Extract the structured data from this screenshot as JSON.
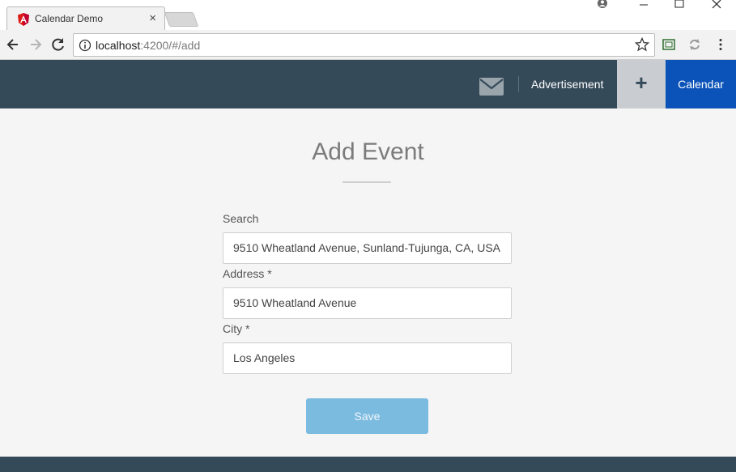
{
  "browser": {
    "tab": {
      "title": "Calendar Demo",
      "favicon": "angular-logo-icon",
      "close_icon": "close-icon"
    },
    "window_controls": [
      "account-icon",
      "minimize-icon",
      "maximize-icon",
      "close-window-icon"
    ],
    "address_bar": {
      "host": "localhost",
      "path": ":4200/#/add"
    },
    "toolbar_icons": [
      "back-icon",
      "forward-icon",
      "reload-icon",
      "info-icon",
      "star-icon",
      "cast-icon",
      "sync-icon",
      "menu-icon"
    ]
  },
  "header": {
    "mail_icon": "envelope-icon",
    "advertisement_label": "Advertisement",
    "add_label": "+",
    "calendar_label": "Calendar",
    "colors": {
      "bar": "#354a59",
      "add_bg": "#c9ccd1",
      "calendar_bg": "#0b53b8"
    }
  },
  "form": {
    "title": "Add Event",
    "fields": [
      {
        "label": "Search",
        "value": "9510 Wheatland Avenue, Sunland-Tujunga, CA, USA"
      },
      {
        "label": "Address *",
        "value": "9510 Wheatland Avenue"
      },
      {
        "label": "City *",
        "value": "Los Angeles"
      }
    ],
    "save_label": "Save",
    "save_color": "#7cbbe0"
  }
}
